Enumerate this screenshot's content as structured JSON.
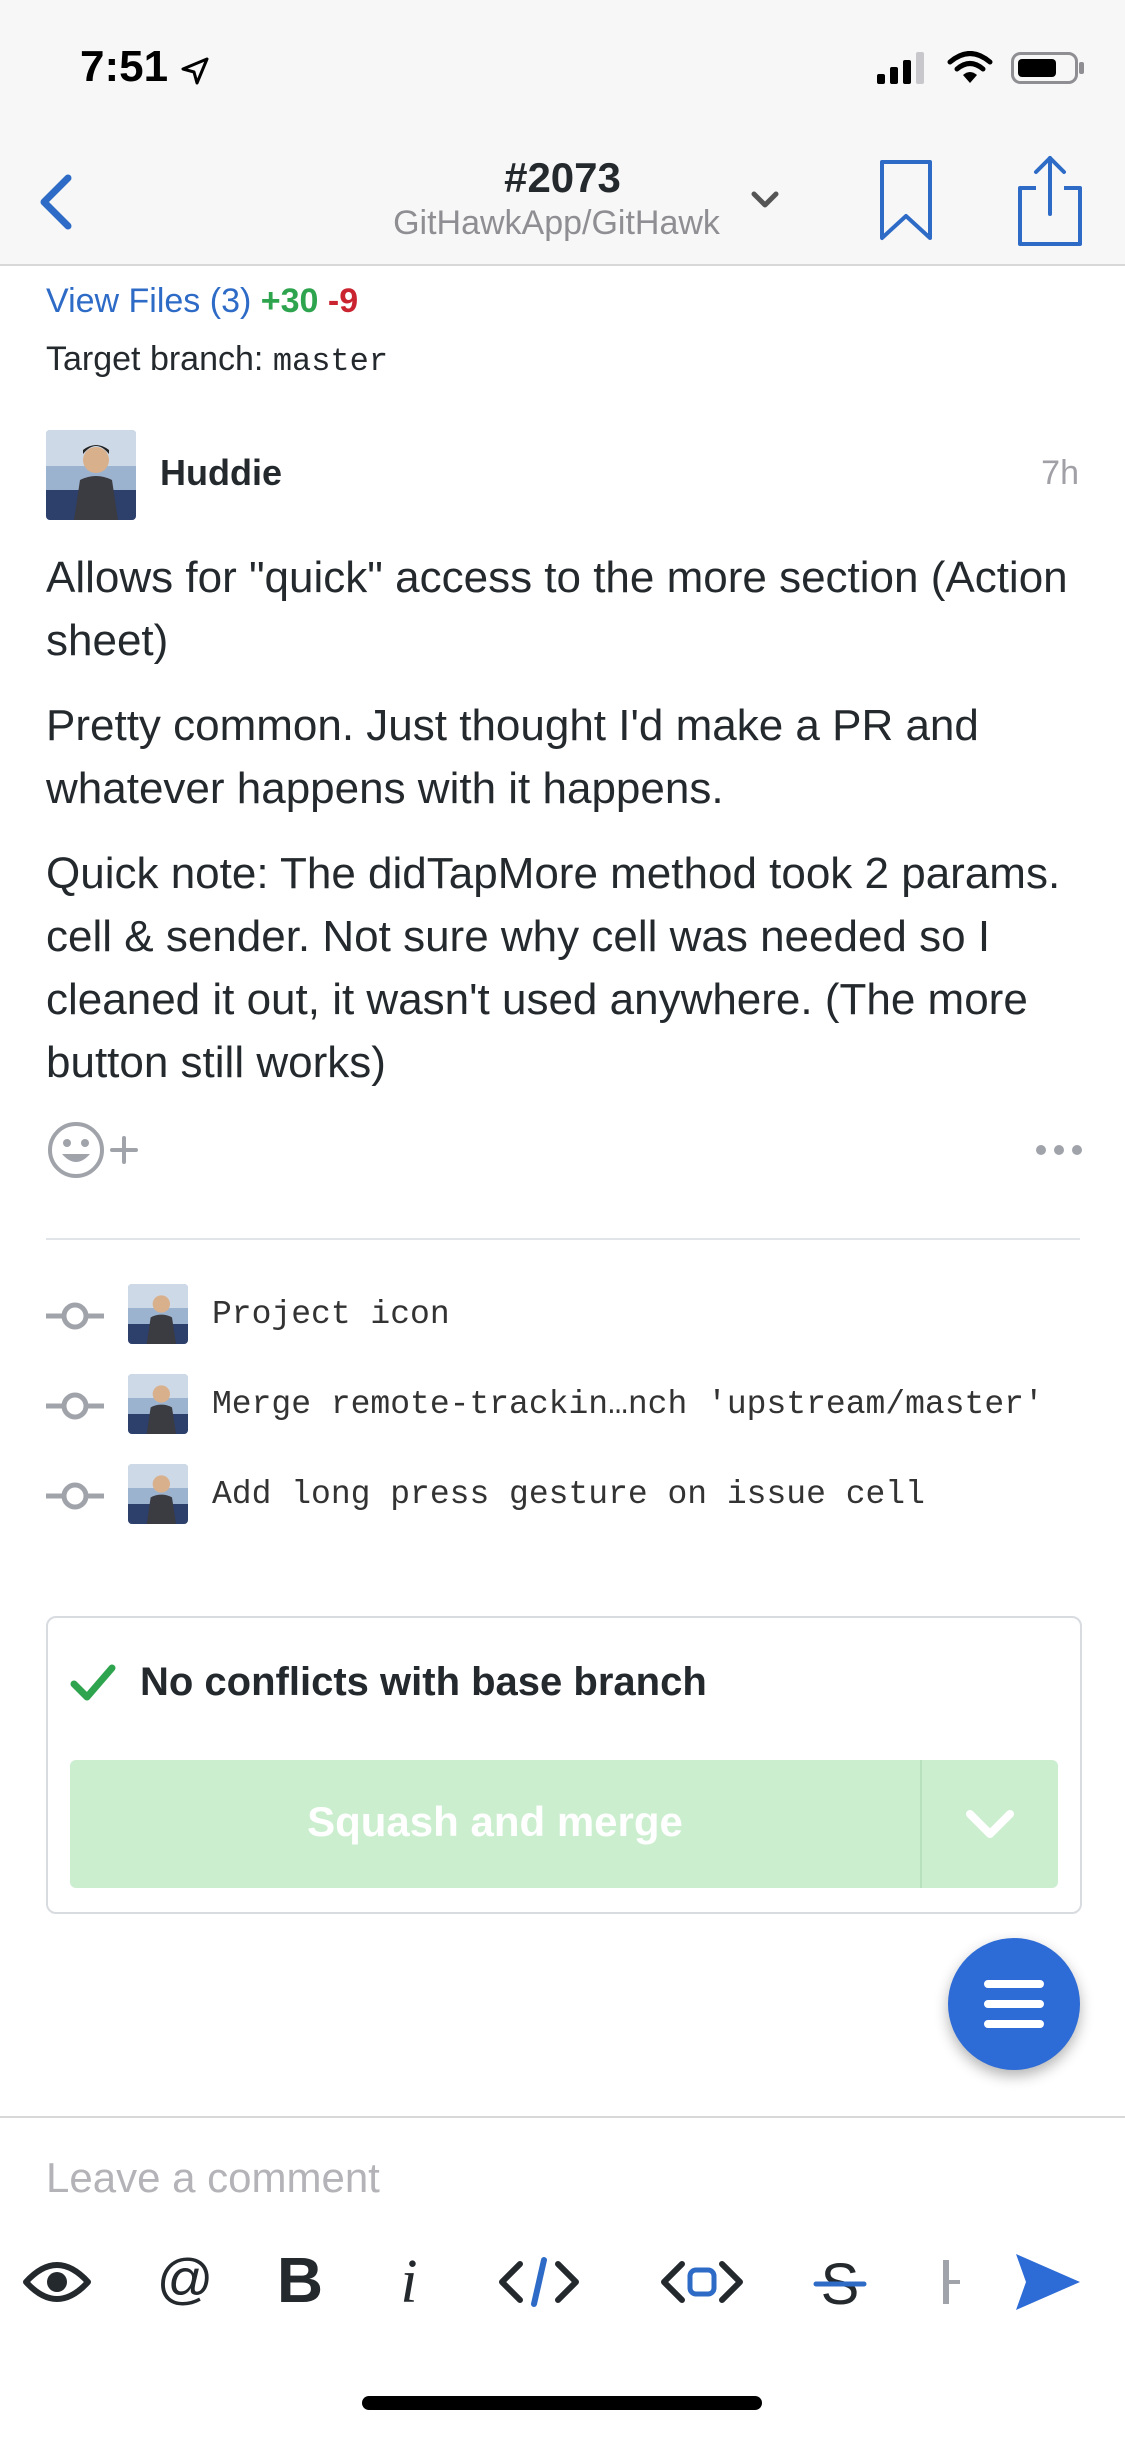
{
  "status_bar": {
    "time": "7:51"
  },
  "nav": {
    "title": "#2073",
    "subtitle": "GitHawkApp/GitHawk"
  },
  "files": {
    "view_label": "View Files (3)",
    "additions": "+30",
    "deletions": "-9"
  },
  "target": {
    "label": "Target branch:",
    "branch": "master"
  },
  "comment": {
    "author": "Huddie",
    "age": "7h",
    "paragraphs": [
      "Allows for \"quick\" access to the more section (Action sheet)",
      "Pretty common. Just thought I'd make a PR and whatever happens with it happens.",
      "Quick note: The didTapMore method took 2 params. cell & sender. Not sure why cell was needed so I cleaned it out, it wasn't used anywhere. (The more button still works)"
    ]
  },
  "commits": [
    {
      "message": "Project icon"
    },
    {
      "message": "Merge remote-trackin…nch 'upstream/master'"
    },
    {
      "message": "Add long press gesture on issue cell"
    }
  ],
  "merge": {
    "status": "No conflicts with base branch",
    "button_label": "Squash and merge"
  },
  "composer": {
    "placeholder": "Leave a comment"
  },
  "colors": {
    "accent": "#2d6bc7",
    "additions": "#2ea44f",
    "deletions": "#cb2431",
    "merge_button": "#cbeecf",
    "fab": "#2d6bd6"
  }
}
